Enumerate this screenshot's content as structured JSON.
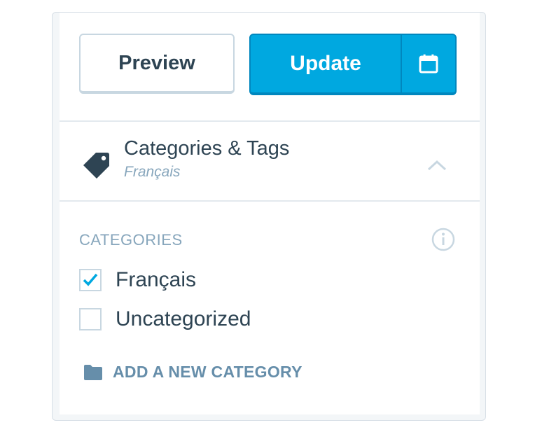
{
  "actions": {
    "preview_label": "Preview",
    "update_label": "Update",
    "schedule_icon": "calendar-icon"
  },
  "categories_section": {
    "title": "Categories & Tags",
    "subtitle": "Français",
    "icon": "tag-icon",
    "toggle_icon": "chevron-up-icon",
    "heading": "CATEGORIES",
    "info_icon": "info-icon",
    "items": [
      {
        "label": "Français",
        "checked": true
      },
      {
        "label": "Uncategorized",
        "checked": false
      }
    ],
    "add_new_label": "ADD A NEW CATEGORY",
    "add_new_icon": "folder-icon"
  },
  "colors": {
    "accent": "#00a8e0",
    "accent_border": "#0087be",
    "text": "#2e4453",
    "muted": "#87a6bc",
    "link": "#668eaa"
  }
}
